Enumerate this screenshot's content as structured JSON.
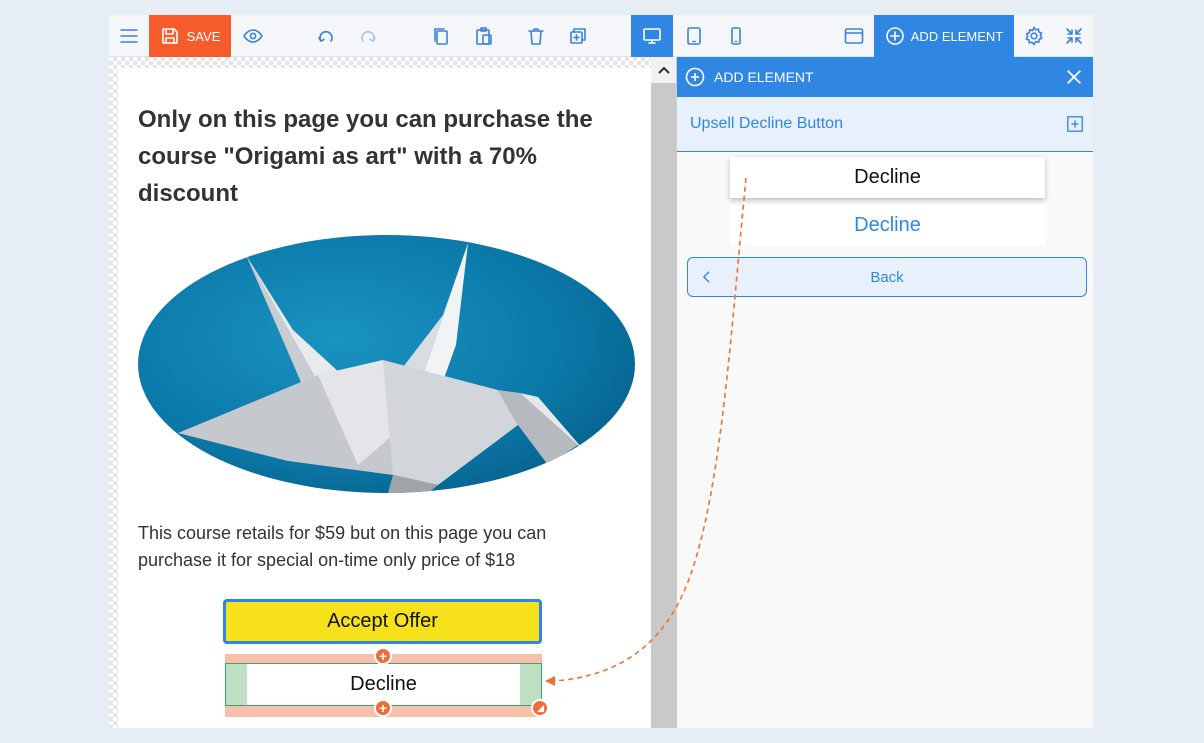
{
  "toolbar": {
    "save_label": "SAVE",
    "add_element_label": "ADD ELEMENT",
    "colors": {
      "accent": "#2f87e3",
      "save": "#f65b2b"
    }
  },
  "page": {
    "headline": "Only on this page you can purchase the course \"Origami as art\" with a 70% discount",
    "retail_text": "This course retails for $59 but on this page you can purchase it for special on-time only price of $18",
    "accept_button": "Accept Offer",
    "decline_button": "Decline"
  },
  "panel": {
    "title": "ADD ELEMENT",
    "section_title": "Upsell Decline Button",
    "options": [
      {
        "label": "Decline",
        "style": "shadow"
      },
      {
        "label": "Decline",
        "style": "link"
      }
    ],
    "back_label": "Back"
  }
}
